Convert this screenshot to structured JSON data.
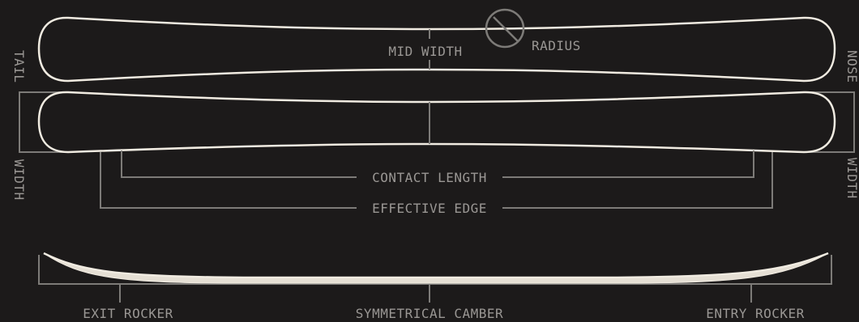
{
  "labels": {
    "tail": "TAIL",
    "tail_width": "WIDTH",
    "nose": "NOSE",
    "nose_width": "WIDTH",
    "mid_width": "MID WIDTH",
    "radius": "RADIUS",
    "contact_length": "CONTACT LENGTH",
    "effective_edge": "EFFECTIVE EDGE",
    "exit_rocker": "EXIT ROCKER",
    "symmetrical_camber": "SYMMETRICAL CAMBER",
    "entry_rocker": "ENTRY ROCKER"
  },
  "colors": {
    "background": "#1c1a1a",
    "board_outline": "#f0ebe1",
    "guide_lines": "#7d7b78",
    "label_text": "#9a9794"
  }
}
